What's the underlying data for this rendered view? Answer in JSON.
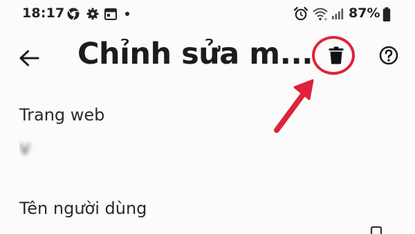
{
  "status_bar": {
    "time": "18:17",
    "battery_percent": "87%",
    "left_icons": [
      "chrome-icon",
      "gear-icon",
      "calendar-icon",
      "dot-icon"
    ],
    "right_icons": [
      "alarm-icon",
      "wifi-icon",
      "signal-icon",
      "battery-icon"
    ]
  },
  "app_bar": {
    "title": "Chỉnh sửa m...",
    "back_icon": "arrow-back-icon",
    "delete_icon": "trash-icon",
    "help_icon": "help-circle-icon"
  },
  "annotation": {
    "highlight_color": "#e0223c",
    "target": "delete-button"
  },
  "fields": {
    "website_label": "Trang web",
    "website_value": "v          n",
    "username_label": "Tên người dùng"
  }
}
